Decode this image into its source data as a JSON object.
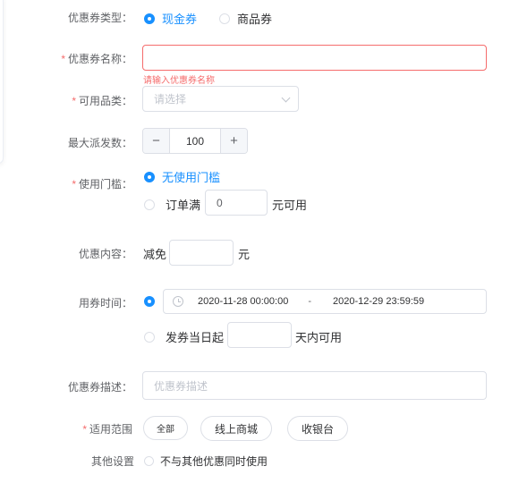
{
  "coupon_type": {
    "label": "优惠券类型：",
    "options": [
      {
        "label": "现金券",
        "selected": true
      },
      {
        "label": "商品券",
        "selected": false
      }
    ]
  },
  "coupon_name": {
    "label": "优惠券名称：",
    "value": "",
    "error": "请输入优惠券名称"
  },
  "category": {
    "label": "可用品类：",
    "placeholder": "请选择"
  },
  "max_issue": {
    "label": "最大派发数：",
    "minus": "−",
    "value": "100",
    "plus": "+"
  },
  "threshold": {
    "label": "使用门槛：",
    "option_none": "无使用门槛",
    "option_order_prefix": "订单满",
    "order_amount": "0",
    "option_order_suffix": "元可用"
  },
  "content": {
    "label": "优惠内容：",
    "prefix": "减免",
    "amount": "",
    "suffix": "元"
  },
  "use_time": {
    "label": "用券时间：",
    "start": "2020-11-28 00:00:00",
    "separator": "-",
    "end": "2020-12-29 23:59:59",
    "relative_prefix": "发券当日起",
    "relative_days": "",
    "relative_suffix": "天内可用"
  },
  "description": {
    "label": "优惠券描述：",
    "placeholder": "优惠券描述"
  },
  "scope": {
    "label": "适用范围",
    "options": [
      "全部",
      "线上商城",
      "收银台"
    ]
  },
  "other": {
    "label": "其他设置",
    "option": "不与其他优惠同时使用"
  },
  "colors": {
    "primary": "#1890ff",
    "error": "#f56c6c",
    "border": "#dcdfe6",
    "placeholder": "#c0c4cc"
  }
}
